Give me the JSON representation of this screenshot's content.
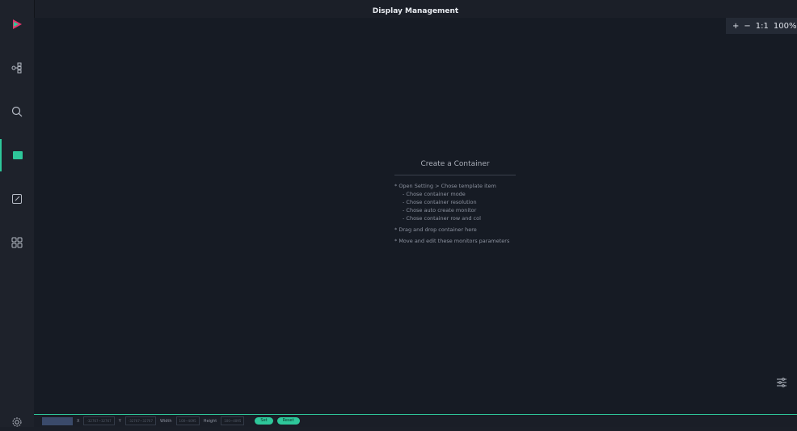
{
  "title": "Display Management",
  "sidebar": {
    "items": [
      "logo",
      "topology",
      "search",
      "display",
      "edit",
      "apps"
    ],
    "settings": "settings"
  },
  "zoom": {
    "plus": "+",
    "minus": "−",
    "one_to_one": "1:1",
    "percent": "100%"
  },
  "center": {
    "heading": "Create a Container",
    "items": [
      {
        "text": "* Open Setting > Chose template item",
        "sub": false
      },
      {
        "text": "- Chose container mode",
        "sub": true
      },
      {
        "text": "- Chose container resolution",
        "sub": true
      },
      {
        "text": "- Chose auto create monitor",
        "sub": true
      },
      {
        "text": "- Chose container row and col",
        "sub": true
      },
      {
        "text": "* Drag and drop container here",
        "sub": false
      },
      {
        "text": "* Move and edit these monitors parameters",
        "sub": false
      }
    ]
  },
  "footer": {
    "x_label": "X",
    "x_placeholder": "-32767~32767",
    "y_label": "Y",
    "y_placeholder": "-32767~32767",
    "width_label": "Width",
    "width_placeholder": "100~4095",
    "height_label": "Height",
    "height_placeholder": "100~4095",
    "set": "Set",
    "reset": "Reset"
  }
}
